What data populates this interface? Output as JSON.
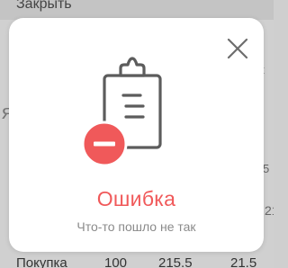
{
  "dialog": {
    "title": "Ошибка",
    "message": "Что-то пошло не так",
    "close_icon": "close-icon",
    "illustration_icon": "clipboard-error-icon",
    "accent_color": "#f0595a"
  },
  "background": {
    "top_text": "Закрыть",
    "left_fragment": "я",
    "right_fragments": [
      "t",
      "5",
      "21"
    ],
    "bottom_row": [
      "Покупка",
      "100",
      "215.5",
      "21.5"
    ]
  }
}
